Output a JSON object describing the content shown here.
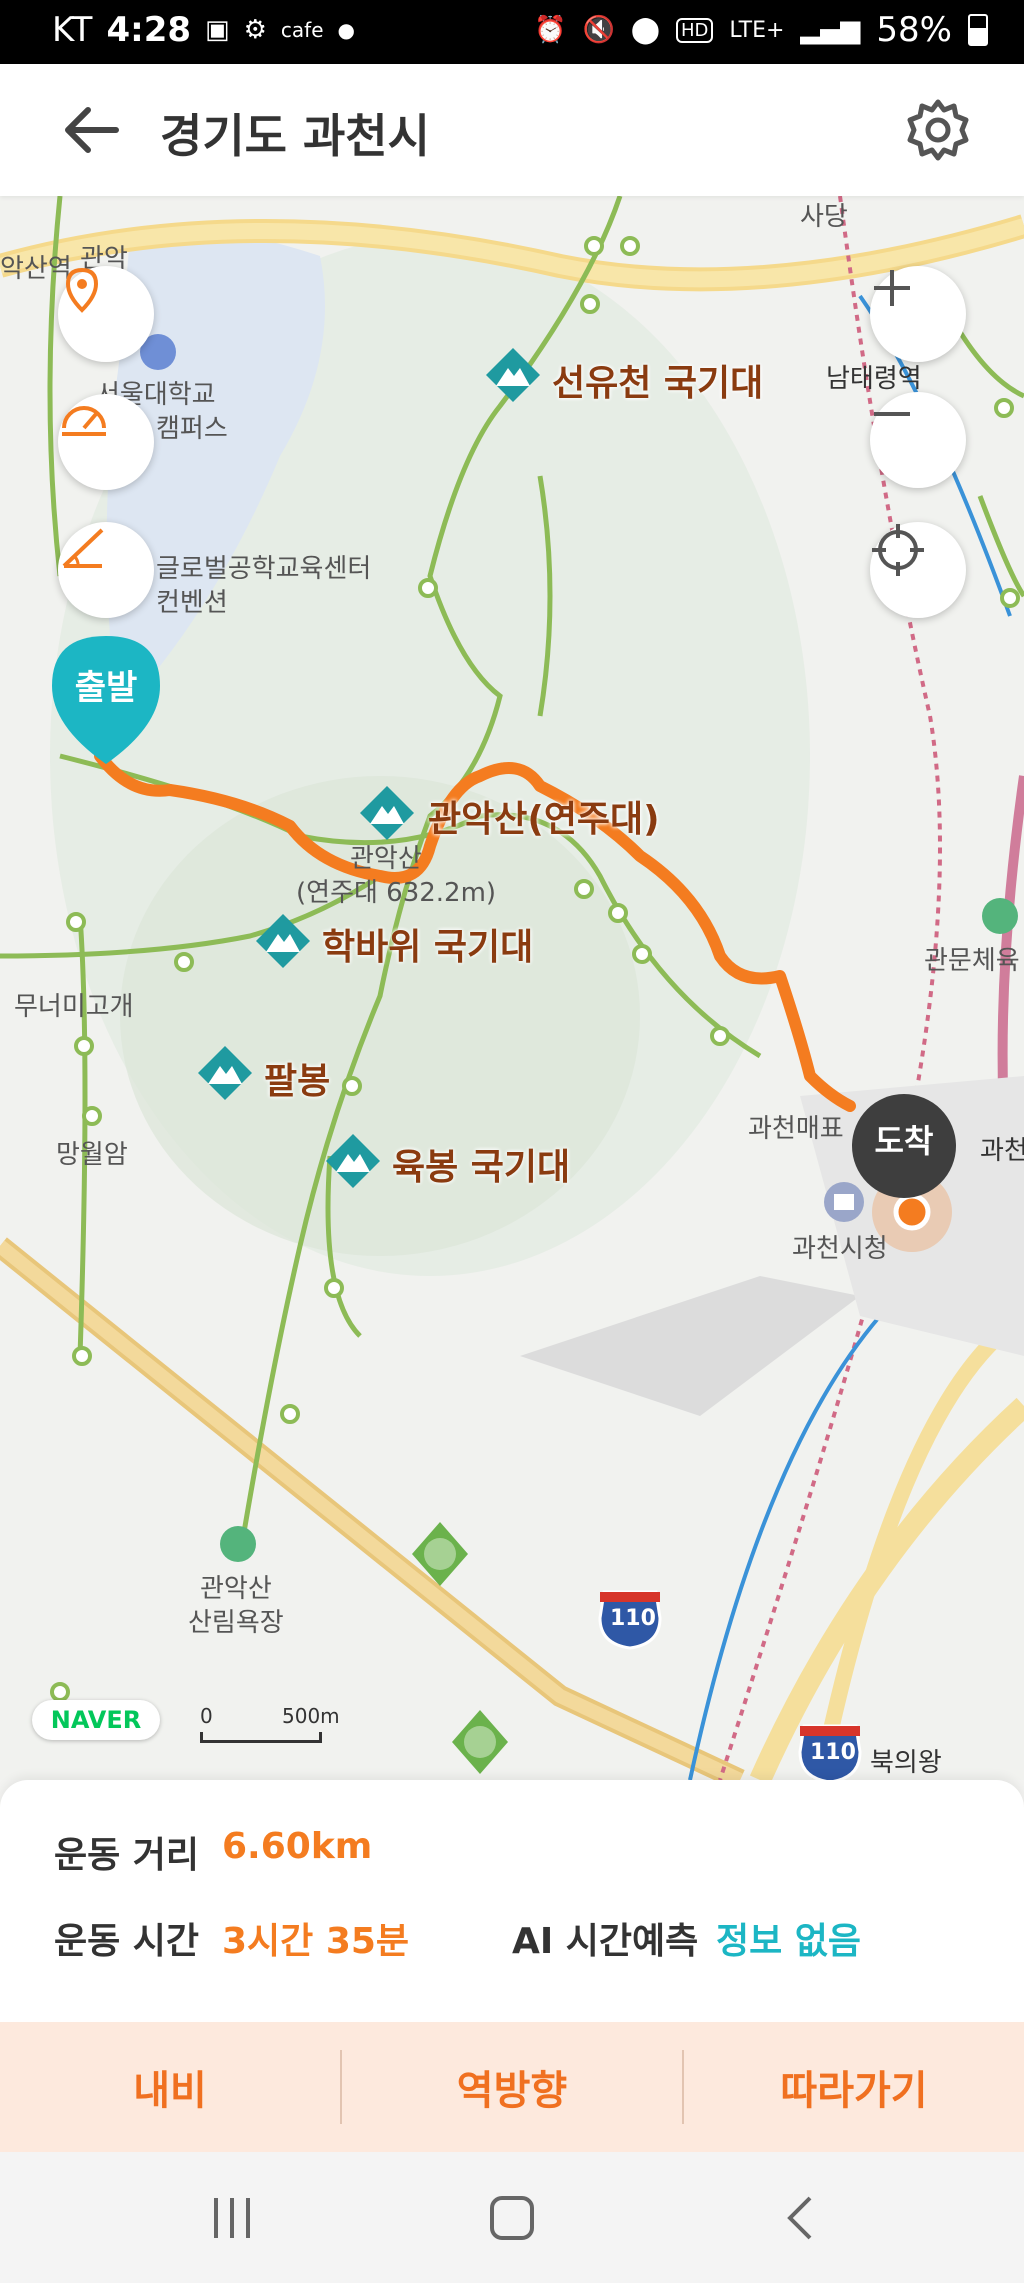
{
  "status_bar": {
    "carrier": "KT",
    "time": "4:28",
    "app_label": "cafe",
    "network": "LTE+",
    "battery": "58%"
  },
  "header": {
    "title": "경기도 과천시"
  },
  "map": {
    "peaks": [
      {
        "name": "선유천 국기대"
      },
      {
        "name": "관악산(연주대)"
      },
      {
        "name": "학바위 국기대"
      },
      {
        "name": "팔봉"
      },
      {
        "name": "육봉 국기대"
      }
    ],
    "labels": {
      "gwanak_station": "악산역",
      "gwanak": "관악",
      "sadang": "사당",
      "snu_line1": "서울대학교",
      "snu_line2": "캠퍼스",
      "namtaeryeong": "남태령역",
      "global_center_line1": "글로벌공학교육센터",
      "global_center_line2": "컨벤션",
      "gwanaksan_line1": "관악산",
      "gwanaksan_line2": "(연주대 632.2m)",
      "muneomigogae": "무너미고개",
      "mangwolam": "망월암",
      "gwacheon_ticket": "과천매표",
      "gwacheon_city_hall": "과천시청",
      "gwacheon_edge": "과천",
      "gwanmun": "관문체육",
      "forest_line1": "관악산",
      "forest_line2": "산림욕장",
      "bukuiwang": "북의왕",
      "highway_110": "110",
      "scale_zero": "0",
      "scale_distance": "500m"
    },
    "start_pin": "출발",
    "arrive_pin": "도착",
    "logo": "NAVER",
    "route_color": "#f47c20"
  },
  "info": {
    "distance_label": "운동 거리",
    "distance_value": "6.60km",
    "time_label": "운동 시간",
    "time_value": "3시간 35분",
    "ai_label": "AI 시간예측",
    "ai_value": "정보 없음"
  },
  "actions": {
    "nav": "내비",
    "reverse": "역방향",
    "follow": "따라가기"
  },
  "colors": {
    "accent_orange": "#f47c20",
    "teal": "#1cb6c4",
    "peak_label": "#8a3b10"
  }
}
